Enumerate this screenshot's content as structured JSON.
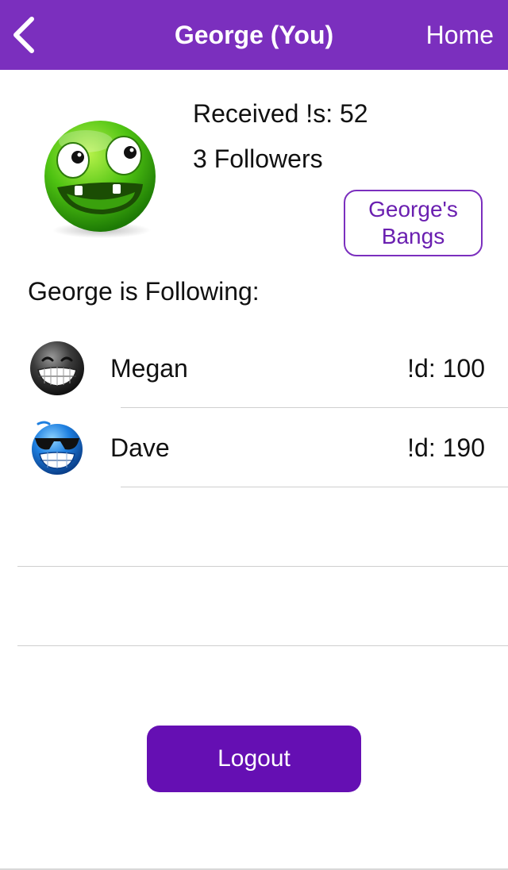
{
  "header": {
    "title": "George (You)",
    "home_label": "Home",
    "bar_color": "#7b2fbe",
    "back_icon": "chevron-left-icon"
  },
  "profile": {
    "avatar_icon": "green-goofy-smiley-avatar",
    "received_text": "Received !s: 52",
    "followers_text": "3 Followers",
    "bangs_button_line1": "George's",
    "bangs_button_line2": "Bangs"
  },
  "following": {
    "label": "George is Following:",
    "items": [
      {
        "name": "Megan",
        "count_text": "!d: 100",
        "avatar_icon": "black-grinning-smiley-avatar"
      },
      {
        "name": "Dave",
        "count_text": "!d: 190",
        "avatar_icon": "blue-sunglasses-smiley-avatar"
      }
    ]
  },
  "logout": {
    "label": "Logout",
    "color": "#650fb3"
  }
}
